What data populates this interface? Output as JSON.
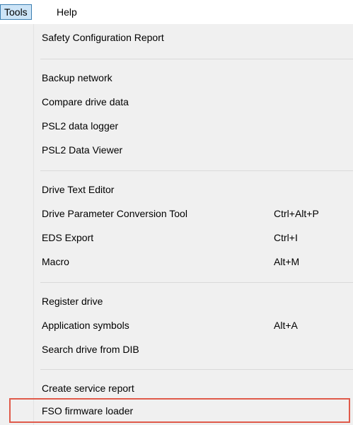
{
  "menubar": {
    "tools_label": "Tools",
    "help_label": "Help"
  },
  "menu": {
    "items": [
      {
        "label": "Safety Configuration Report",
        "shortcut": ""
      },
      {
        "label": "Backup network",
        "shortcut": ""
      },
      {
        "label": "Compare drive data",
        "shortcut": ""
      },
      {
        "label": "PSL2 data logger",
        "shortcut": ""
      },
      {
        "label": "PSL2 Data Viewer",
        "shortcut": ""
      },
      {
        "label": "Drive Text Editor",
        "shortcut": ""
      },
      {
        "label": "Drive Parameter Conversion Tool",
        "shortcut": "Ctrl+Alt+P"
      },
      {
        "label": "EDS Export",
        "shortcut": "Ctrl+I"
      },
      {
        "label": "Macro",
        "shortcut": "Alt+M"
      },
      {
        "label": "Register drive",
        "shortcut": ""
      },
      {
        "label": "Application symbols",
        "shortcut": "Alt+A"
      },
      {
        "label": "Search drive from DIB",
        "shortcut": ""
      },
      {
        "label": "Create service report",
        "shortcut": ""
      },
      {
        "label": "FSO firmware loader",
        "shortcut": ""
      }
    ]
  },
  "colors": {
    "active_menu_bg": "#cce4f7",
    "active_menu_border": "#3c7fb1",
    "dropdown_bg": "#f0f0f0",
    "highlight_border": "#e05a4a"
  }
}
